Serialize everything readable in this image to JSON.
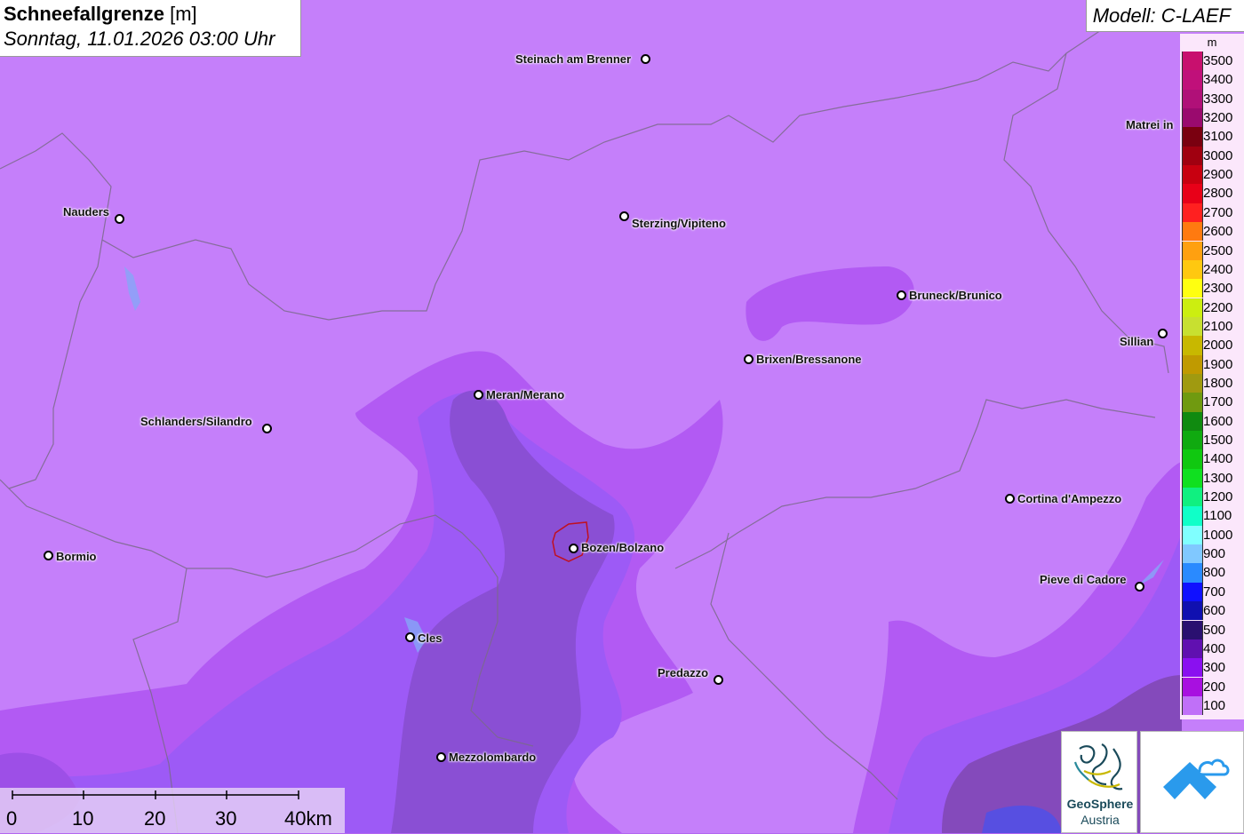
{
  "header": {
    "title_bold": "Schneefallgrenze",
    "title_unit": "[m]",
    "subtitle": "Sonntag, 11.01.2026 03:00 Uhr",
    "model": "Modell: C-LAEF"
  },
  "legend": {
    "unit": "m",
    "levels": [
      {
        "label": "3500",
        "color": "#c8106e"
      },
      {
        "label": "3400",
        "color": "#c0107a"
      },
      {
        "label": "3300",
        "color": "#b01078"
      },
      {
        "label": "3200",
        "color": "#9a0a6e"
      },
      {
        "label": "3100",
        "color": "#7a0010"
      },
      {
        "label": "3000",
        "color": "#a00010"
      },
      {
        "label": "2900",
        "color": "#c80010"
      },
      {
        "label": "2800",
        "color": "#e80018"
      },
      {
        "label": "2700",
        "color": "#ff2020"
      },
      {
        "label": "2600",
        "color": "#ff7a10"
      },
      {
        "label": "2500",
        "color": "#ffa010"
      },
      {
        "label": "2400",
        "color": "#ffc810"
      },
      {
        "label": "2300",
        "color": "#ffff10"
      },
      {
        "label": "2200",
        "color": "#ccee10"
      },
      {
        "label": "2100",
        "color": "#c8e030"
      },
      {
        "label": "2000",
        "color": "#c8b800"
      },
      {
        "label": "1900",
        "color": "#c09a00"
      },
      {
        "label": "1800",
        "color": "#a09a10"
      },
      {
        "label": "1700",
        "color": "#709a10"
      },
      {
        "label": "1600",
        "color": "#108a10"
      },
      {
        "label": "1500",
        "color": "#10aa10"
      },
      {
        "label": "1400",
        "color": "#10c810"
      },
      {
        "label": "1300",
        "color": "#10e020"
      },
      {
        "label": "1200",
        "color": "#10f080"
      },
      {
        "label": "1100",
        "color": "#10ffc8"
      },
      {
        "label": "1000",
        "color": "#80ffff"
      },
      {
        "label": "900",
        "color": "#80c8ff"
      },
      {
        "label": "800",
        "color": "#2a8aff"
      },
      {
        "label": "700",
        "color": "#1010ff"
      },
      {
        "label": "600",
        "color": "#1010b0"
      },
      {
        "label": "500",
        "color": "#2a1070"
      },
      {
        "label": "400",
        "color": "#6010b0"
      },
      {
        "label": "300",
        "color": "#8a10f0"
      },
      {
        "label": "200",
        "color": "#a810e0"
      },
      {
        "label": "100",
        "color": "#c070f8"
      }
    ]
  },
  "cities": [
    {
      "name": "Steinach am Brenner"
    },
    {
      "name": "Matrei in"
    },
    {
      "name": "Nauders"
    },
    {
      "name": "Sterzing/Vipiteno"
    },
    {
      "name": "Bruneck/Brunico"
    },
    {
      "name": "Sillian"
    },
    {
      "name": "Brixen/Bressanone"
    },
    {
      "name": "Meran/Merano"
    },
    {
      "name": "Schlanders/Silandro"
    },
    {
      "name": "Cortina d'Ampezzo"
    },
    {
      "name": "Bozen/Bolzano"
    },
    {
      "name": "Bormio"
    },
    {
      "name": "Pieve di Cadore"
    },
    {
      "name": "Cles"
    },
    {
      "name": "Predazzo"
    },
    {
      "name": "Mezzolombardo"
    }
  ],
  "scalebar": {
    "labels": [
      "0",
      "10",
      "20",
      "30",
      "40km"
    ]
  },
  "logos": {
    "geosphere_line1": "GeoSphere",
    "geosphere_line2": "Austria"
  }
}
